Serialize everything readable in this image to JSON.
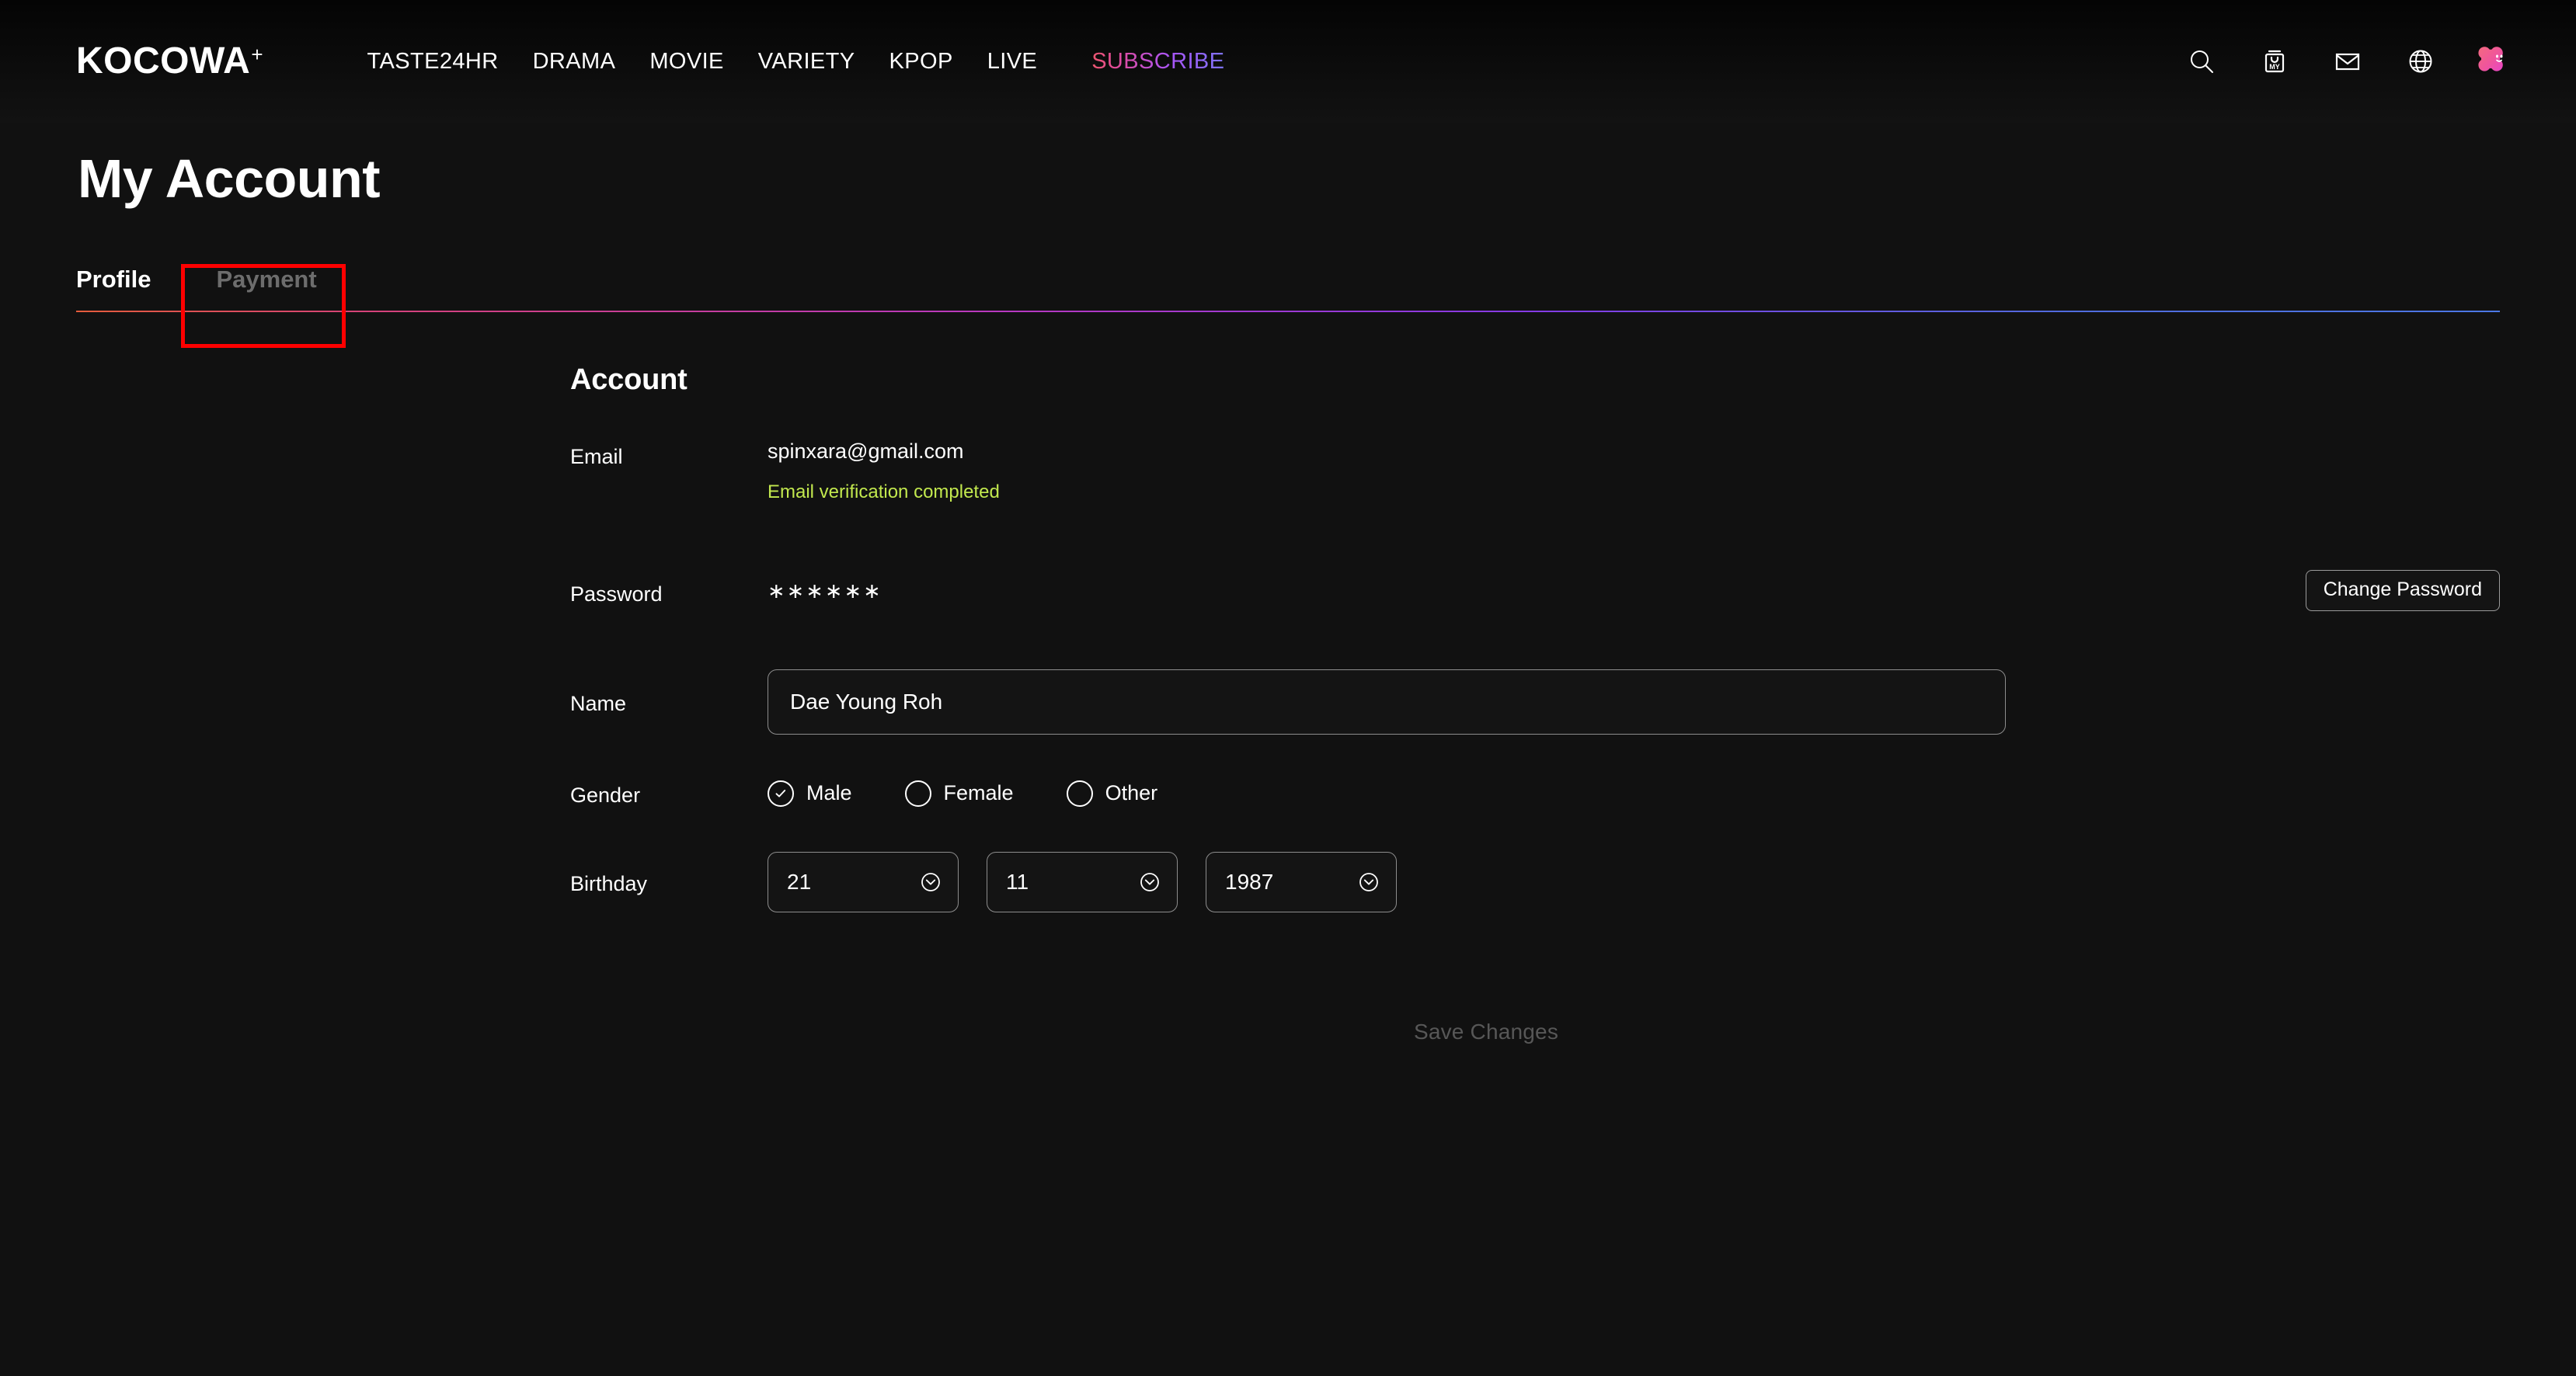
{
  "header": {
    "logo": {
      "text": "KOCOWA",
      "plus": "+"
    },
    "nav": [
      {
        "label": "TASTE24HR",
        "name": "nav-taste24hr"
      },
      {
        "label": "DRAMA",
        "name": "nav-drama"
      },
      {
        "label": "MOVIE",
        "name": "nav-movie"
      },
      {
        "label": "VARIETY",
        "name": "nav-variety"
      },
      {
        "label": "KPOP",
        "name": "nav-kpop"
      },
      {
        "label": "LIVE",
        "name": "nav-live"
      }
    ],
    "subscribe_label": "SUBSCRIBE",
    "icons": [
      "search-icon",
      "my-bag-icon",
      "mail-icon",
      "globe-icon",
      "avatar"
    ],
    "my_bag_text": "MY",
    "subscribe_gradient": [
      "#f2604f",
      "#a855f7",
      "#6f7df5"
    ]
  },
  "page": {
    "title": "My Account"
  },
  "tabs": {
    "items": [
      {
        "label": "Profile",
        "active": true
      },
      {
        "label": "Payment",
        "active": false
      }
    ],
    "divider_gradient": [
      "#f0603e",
      "#c13bc9",
      "#4f7df0"
    ],
    "highlight_color": "#ff0000"
  },
  "form": {
    "section_title": "Account",
    "email": {
      "label": "Email",
      "value": "spinxara@gmail.com",
      "verification_note": "Email verification completed",
      "verification_color": "#c2e84e"
    },
    "password": {
      "label": "Password",
      "masked_value": "∗∗∗∗∗∗",
      "change_button": "Change Password"
    },
    "name": {
      "label": "Name",
      "value": "Dae Young Roh",
      "placeholder": "Name"
    },
    "gender": {
      "label": "Gender",
      "options": [
        {
          "label": "Male",
          "selected": true
        },
        {
          "label": "Female",
          "selected": false
        },
        {
          "label": "Other",
          "selected": false
        }
      ]
    },
    "birthday": {
      "label": "Birthday",
      "day": "21",
      "month": "11",
      "year": "1987"
    },
    "save_label": "Save Changes"
  }
}
